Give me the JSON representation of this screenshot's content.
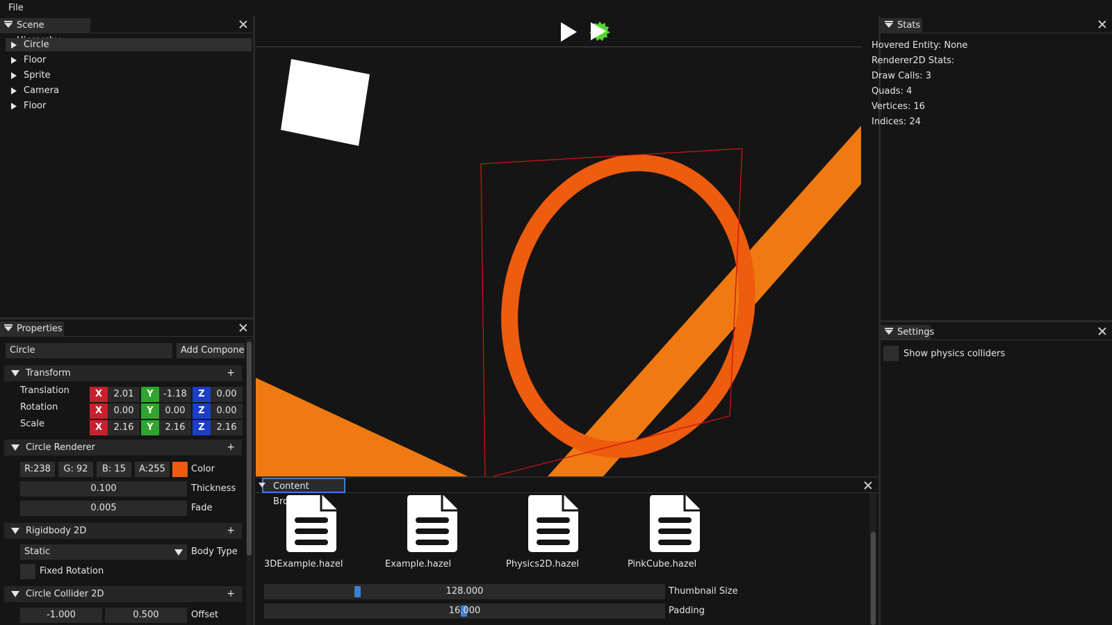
{
  "menubar": {
    "file": "File"
  },
  "hierarchy": {
    "tab": "Scene Hierarchy",
    "items": [
      "Circle",
      "Floor",
      "Sprite",
      "Camera",
      "Floor"
    ]
  },
  "properties": {
    "tab": "Properties",
    "entity_name": "Circle",
    "add_component": "Add Componer",
    "transform": {
      "title": "Transform",
      "plus": "+",
      "rows": [
        {
          "label": "Translation",
          "x": "2.01",
          "y": "-1.18",
          "z": "0.00"
        },
        {
          "label": "Rotation",
          "x": "0.00",
          "y": "0.00",
          "z": "0.00"
        },
        {
          "label": "Scale",
          "x": "2.16",
          "y": "2.16",
          "z": "2.16"
        }
      ],
      "axis_x": "X",
      "axis_y": "Y",
      "axis_z": "Z"
    },
    "circle_renderer": {
      "title": "Circle Renderer",
      "plus": "+",
      "r": "R:238",
      "g": "G: 92",
      "b": "B: 15",
      "a": "A:255",
      "color_label": "Color",
      "color_swatch": "#ee5c0f",
      "thickness": "0.100",
      "thickness_label": "Thickness",
      "fade": "0.005",
      "fade_label": "Fade"
    },
    "rigidbody": {
      "title": "Rigidbody 2D",
      "plus": "+",
      "body_type": "Static",
      "body_type_label": "Body Type",
      "fixed_rotation_label": "Fixed Rotation"
    },
    "circle_collider": {
      "title": "Circle Collider 2D",
      "plus": "+",
      "offset_x": "-1.000",
      "offset_y": "0.500",
      "offset_label": "Offset"
    }
  },
  "stats": {
    "tab": "Stats",
    "lines": [
      "Hovered Entity: None",
      "Renderer2D Stats:",
      "Draw Calls: 3",
      "Quads: 4",
      "Vertices: 16",
      "Indices: 24"
    ]
  },
  "settings": {
    "tab": "Settings",
    "show_colliders": "Show physics colliders"
  },
  "content_browser": {
    "tab": "Content Browser",
    "files": [
      "3DExample.hazel",
      "Example.hazel",
      "Physics2D.hazel",
      "PinkCube.hazel"
    ],
    "thumbnail_size": "128.000",
    "thumbnail_size_label": "Thumbnail Size",
    "padding": "16.000",
    "padding_label": "Padding"
  },
  "colors": {
    "accent_orange": "#f07a12",
    "circle_orange": "#ee5c0f",
    "collider_red": "#d01414",
    "play_green": "#55d62f"
  },
  "icons": [
    "play-icon",
    "simulate-icon",
    "file-icon",
    "close-icon",
    "collapse-arrow-icon"
  ]
}
